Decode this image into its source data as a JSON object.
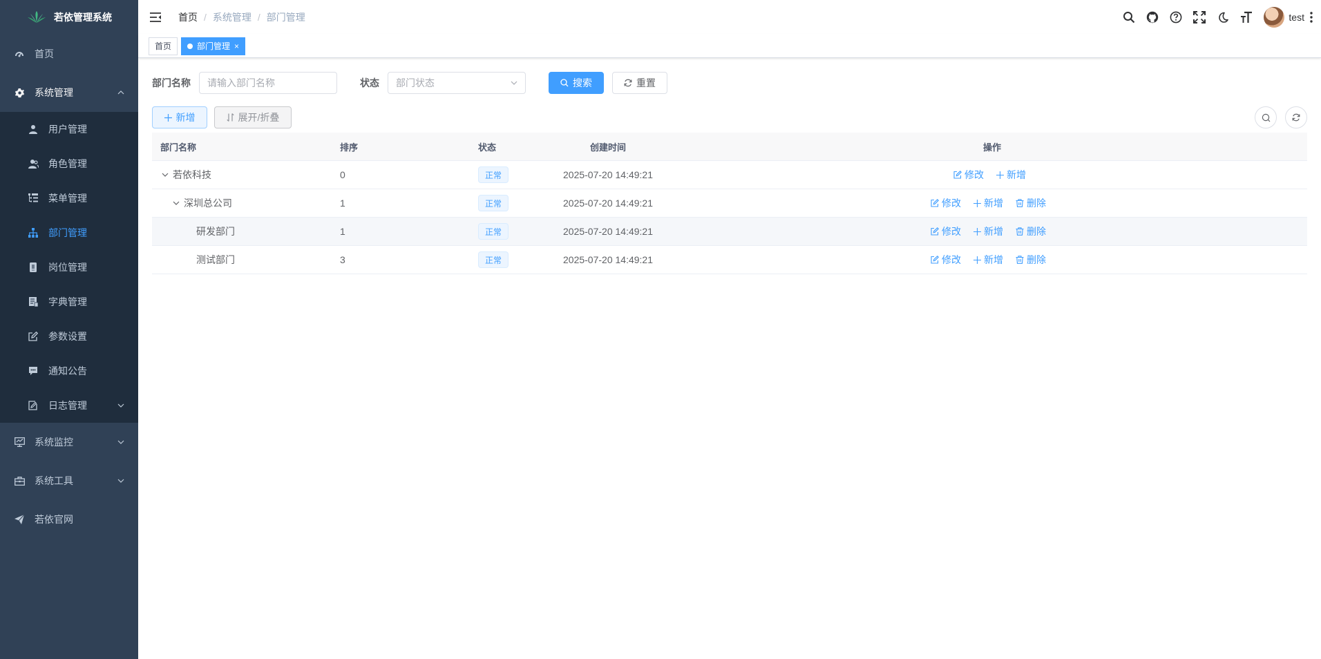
{
  "app": {
    "title": "若依管理系统"
  },
  "sidebar": {
    "home": "首页",
    "system": "系统管理",
    "system_items": [
      "用户管理",
      "角色管理",
      "菜单管理",
      "部门管理",
      "岗位管理",
      "字典管理",
      "参数设置",
      "通知公告",
      "日志管理"
    ],
    "monitor": "系统监控",
    "tools": "系统工具",
    "website": "若依官网"
  },
  "breadcrumb": [
    "首页",
    "系统管理",
    "部门管理"
  ],
  "user": {
    "name": "test"
  },
  "tags": {
    "home": "首页",
    "active": "部门管理",
    "close": "×"
  },
  "search": {
    "dept_label": "部门名称",
    "dept_placeholder": "请输入部门名称",
    "status_label": "状态",
    "status_placeholder": "部门状态",
    "search_btn": "搜索",
    "reset_btn": "重置"
  },
  "toolbar": {
    "add": "新增",
    "expand": "展开/折叠"
  },
  "table": {
    "headers": [
      "部门名称",
      "排序",
      "状态",
      "创建时间",
      "操作"
    ],
    "rows": [
      {
        "name": "若依科技",
        "order": "0",
        "status": "正常",
        "time": "2025-07-20 14:49:21"
      },
      {
        "name": "深圳总公司",
        "order": "1",
        "status": "正常",
        "time": "2025-07-20 14:49:21"
      },
      {
        "name": "研发部门",
        "order": "1",
        "status": "正常",
        "time": "2025-07-20 14:49:21"
      },
      {
        "name": "测试部门",
        "order": "3",
        "status": "正常",
        "time": "2025-07-20 14:49:21"
      }
    ],
    "ops": {
      "edit": "修改",
      "add": "新增",
      "delete": "删除"
    }
  },
  "colors": {
    "sidebar_bg": "#304156",
    "submenu_bg": "#1f2d3d",
    "primary": "#409eff"
  }
}
